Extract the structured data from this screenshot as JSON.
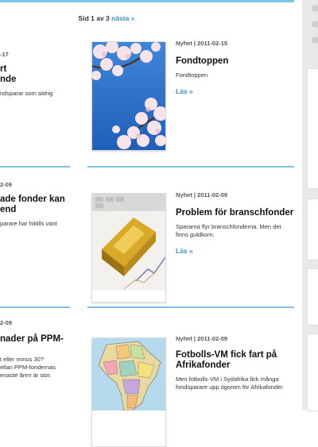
{
  "pager": {
    "prefix": "Sid 1 av 3",
    "next": "nästa »"
  },
  "left_column": [
    {
      "meta": "-17",
      "title_line1": "rt",
      "title_line2": "nde",
      "desc": "ndsparar som aldrig"
    },
    {
      "meta": "2-09",
      "title_line1": "ade fonder kan",
      "title_line2": "end",
      "desc": "parare har hittills vänt"
    },
    {
      "meta": "2-09",
      "title_line1": "nader på PPM-",
      "title_line2": "",
      "desc1": "t eller minus 30?",
      "desc2": "ellan PPM-fondernas",
      "desc3": "enaste åren är stor."
    }
  ],
  "articles": [
    {
      "meta": "Nyhet | 2011-02-15",
      "title": "Fondtoppen",
      "desc": "Fondtoppen",
      "more": "Läs »",
      "image": "cherry-blossom-image"
    },
    {
      "meta": "Nyhet | 2011-02-09",
      "title": "Problem för branschfonder",
      "desc": "Spararna flyr branschfonderna. Men det finns guldkorn.",
      "more": "Läs »",
      "image": "gold-bar-image"
    },
    {
      "meta": "Nyhet | 2011-02-09",
      "title": "Fotbolls-VM fick fart på Afrikafonder",
      "desc": "Men fotbolls-VM i Sydafrika fick många fondsparare upp ögonen för Afrikafonder.",
      "image": "africa-map-image"
    }
  ],
  "colors": {
    "accent": "#7ac4e6",
    "link": "#3b8fc2"
  }
}
